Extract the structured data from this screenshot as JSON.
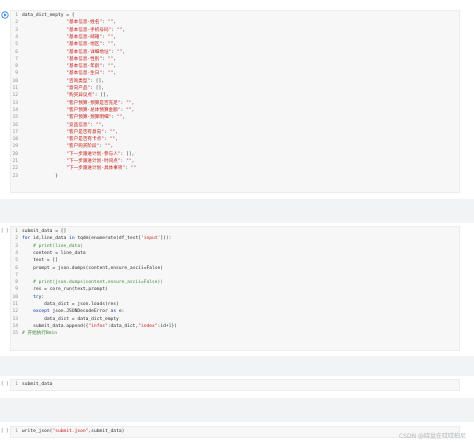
{
  "cell1": {
    "lines": [
      {
        "n": "1",
        "t": "data_dict_empty = {"
      },
      {
        "n": "2",
        "t": "                \"基本信息-姓名\": \"\","
      },
      {
        "n": "3",
        "t": "                \"基本信息-手机号码\": \"\","
      },
      {
        "n": "4",
        "t": "                \"基本信息-邮箱\": \"\","
      },
      {
        "n": "5",
        "t": "                \"基本信息-地区\": \"\","
      },
      {
        "n": "6",
        "t": "                \"基本信息-详细地址\": \"\","
      },
      {
        "n": "7",
        "t": "                \"基本信息-性别\": \"\","
      },
      {
        "n": "8",
        "t": "                \"基本信息-年龄\": \"\","
      },
      {
        "n": "9",
        "t": "                \"基本信息-生日\": \"\","
      },
      {
        "n": "10",
        "t": "                \"咨询类型\": [],"
      },
      {
        "n": "11",
        "t": "                \"意向产品\": [],"
      },
      {
        "n": "12",
        "t": "                \"购买异议点\": [],"
      },
      {
        "n": "13",
        "t": "                \"客户预算-预算是否充足\": \"\","
      },
      {
        "n": "14",
        "t": "                \"客户预算-总体预算金额\": \"\","
      },
      {
        "n": "15",
        "t": "                \"客户预算-预算明细\": \"\","
      },
      {
        "n": "16",
        "t": "                \"竞品信息\": \"\","
      },
      {
        "n": "17",
        "t": "                \"客户是否有意向\": \"\","
      },
      {
        "n": "18",
        "t": "                \"客户是否有卡点\": \"\","
      },
      {
        "n": "19",
        "t": "                \"客户购买阶段\": \"\","
      },
      {
        "n": "20",
        "t": "                \"下一步跟进计划-参与人\": [],"
      },
      {
        "n": "21",
        "t": "                \"下一步跟进计划-时间点\": \"\","
      },
      {
        "n": "22",
        "t": "                \"下一步跟进计划-具体事项\": \"\""
      },
      {
        "n": "23",
        "t": "            }"
      }
    ]
  },
  "cell2": {
    "exec_mark": "[ ]",
    "lines": [
      {
        "n": "1",
        "t": "submit_data = []"
      },
      {
        "n": "2",
        "t": "for id,line_data in tqdm(enumerate(df_test['input'])):"
      },
      {
        "n": "3",
        "t": "    # print(line_data)"
      },
      {
        "n": "4",
        "t": "    content = line_data"
      },
      {
        "n": "5",
        "t": "    text = []"
      },
      {
        "n": "6",
        "t": "    prompt = json.dumps(content,ensure_ascii=False)"
      },
      {
        "n": "7",
        "t": ""
      },
      {
        "n": "8",
        "t": "    # print(json.dumps(content,ensure_ascii=False))"
      },
      {
        "n": "9",
        "t": "    res = core_run(text,prompt)"
      },
      {
        "n": "10",
        "t": "    try:"
      },
      {
        "n": "11",
        "t": "        data_dict = json.loads(res)"
      },
      {
        "n": "12",
        "t": "    except json.JSONDecodeError as e:"
      },
      {
        "n": "13",
        "t": "        data_dict = data_dict_empty"
      },
      {
        "n": "14",
        "t": "    submit_data.append({\"infos\":data_dict,\"index\":id+1})"
      },
      {
        "n": "15",
        "t": "# 开始执行Bmin"
      }
    ]
  },
  "cell3": {
    "exec_mark": "[ ]",
    "lines": [
      {
        "n": "1",
        "t": "submit_data"
      }
    ]
  },
  "cell4": {
    "exec_mark": "[ ]",
    "lines": [
      {
        "n": "1",
        "t": "write_json(\"submit.json\",submit_data)"
      }
    ]
  },
  "watermark": "CSDN @晓盆在哎哎柏尼",
  "colors": {
    "editor_bg": "#f7f7f7",
    "gap_bg": "#f1f3f5",
    "string": "#c41a16",
    "keyword": "#0033b3",
    "comment": "#3a8b3a"
  }
}
